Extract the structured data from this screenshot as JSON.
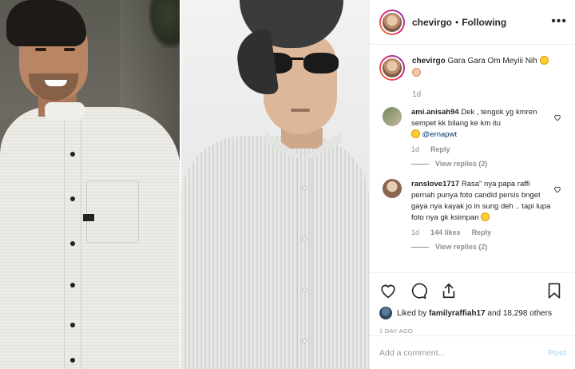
{
  "header": {
    "username": "chevirgo",
    "separator": "•",
    "follow_status": "Following",
    "more_label": "•••"
  },
  "caption": {
    "username": "chevirgo",
    "text": "Gara Gara Om Meyiii Nih",
    "age": "1d"
  },
  "comments": [
    {
      "username": "ami.anisah94",
      "text": "Dek , tengok yg kmren sempet kk bilang ke km itu",
      "mention": "@ernapwt",
      "age": "1d",
      "reply_label": "Reply",
      "view_replies": "View replies (2)"
    },
    {
      "username": "ranslove1717",
      "text": "Rasa\" nya papa raffi pernah punya foto candid persis bnget gaya nya kayak jo in sung deh .. tapi lupa foto nya gk ksimpan",
      "age": "1d",
      "likes": "144 likes",
      "reply_label": "Reply",
      "view_replies": "View replies (2)"
    }
  ],
  "actions": {
    "liked_by_prefix": "Liked by",
    "liked_by_user": "familyraffiah17",
    "liked_by_suffix": "and 18,298 others",
    "post_age": "1 DAY AGO"
  },
  "add_comment": {
    "placeholder": "Add a comment...",
    "post_label": "Post"
  },
  "icons": {
    "like": "heart-icon",
    "comment": "comment-icon",
    "share": "share-icon",
    "save": "bookmark-icon",
    "more": "more-icon"
  }
}
